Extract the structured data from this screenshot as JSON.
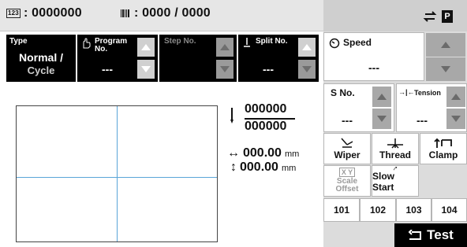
{
  "counter": {
    "count": ": 0000000",
    "batch": ": 0000 / 0000",
    "badge": "123"
  },
  "fields": {
    "type_label": "Type",
    "type_value_line1": "Normal /",
    "type_value_line2": "Cycle",
    "program_label_line1": "Program",
    "program_label_line2": "No.",
    "program_value": "---",
    "step_label": "Step No.",
    "split_label": "Split No.",
    "split_value": "---"
  },
  "speed": {
    "label": "Speed",
    "value": "---"
  },
  "stitch": {
    "label": "S No.",
    "value": "---"
  },
  "tension": {
    "label": "Tension",
    "value": "---"
  },
  "tools": {
    "wiper": "Wiper",
    "thread": "Thread",
    "clamp": "Clamp",
    "scale_line1": "Scale",
    "scale_line2": "Offset",
    "slow_start": "Slow Start"
  },
  "numbers": [
    "101",
    "102",
    "103",
    "104"
  ],
  "test_label": "Test",
  "stitch_counts": {
    "top": "000000",
    "bottom": "000000"
  },
  "dims": {
    "x": "000.00",
    "y": "000.00",
    "unit": "mm"
  },
  "colors": {
    "accent_line": "#5aa5d8",
    "dark": "#000000"
  }
}
